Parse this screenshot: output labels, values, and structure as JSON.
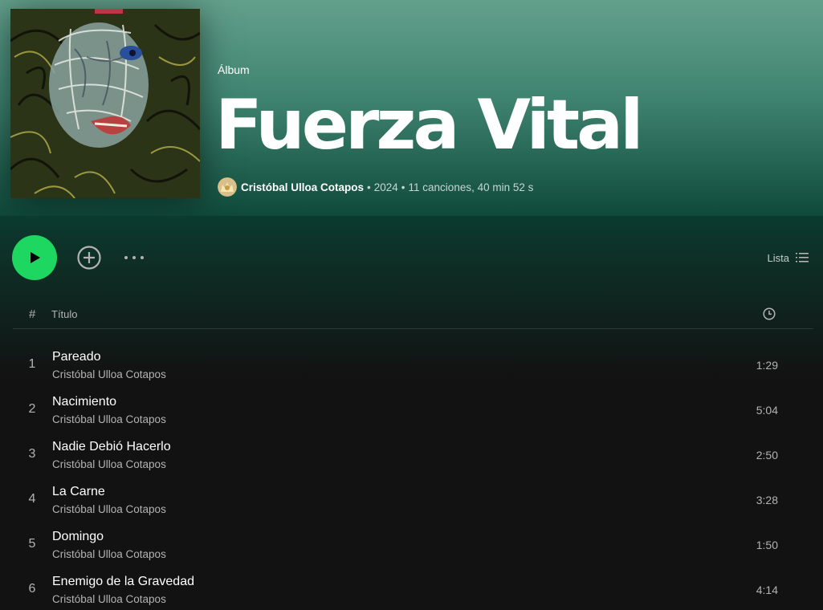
{
  "album": {
    "type_label": "Álbum",
    "title": "Fuerza Vital",
    "artist": "Cristóbal Ulloa Cotapos",
    "year": "2024",
    "stats": "11 canciones, 40 min 52 s",
    "separator": "•"
  },
  "actions": {
    "play_icon": "play-icon",
    "add_icon": "add-circle-icon",
    "more_icon": "more-dots-icon",
    "view_label": "Lista",
    "view_icon": "list-icon"
  },
  "list_header": {
    "number": "#",
    "title": "Título",
    "duration_icon": "clock-icon"
  },
  "tracks": [
    {
      "number": "1",
      "title": "Pareado",
      "artist": "Cristóbal Ulloa Cotapos",
      "duration": "1:29"
    },
    {
      "number": "2",
      "title": "Nacimiento",
      "artist": "Cristóbal Ulloa Cotapos",
      "duration": "5:04"
    },
    {
      "number": "3",
      "title": "Nadie Debió Hacerlo",
      "artist": "Cristóbal Ulloa Cotapos",
      "duration": "2:50"
    },
    {
      "number": "4",
      "title": "La Carne",
      "artist": "Cristóbal Ulloa Cotapos",
      "duration": "3:28"
    },
    {
      "number": "5",
      "title": "Domingo",
      "artist": "Cristóbal Ulloa Cotapos",
      "duration": "1:50"
    },
    {
      "number": "6",
      "title": "Enemigo de la Gravedad",
      "artist": "Cristóbal Ulloa Cotapos",
      "duration": "4:14"
    }
  ],
  "colors": {
    "accent": "#1ed760",
    "header_top": "#63a08c",
    "header_bottom": "#0f4a3a",
    "background": "#121212"
  }
}
